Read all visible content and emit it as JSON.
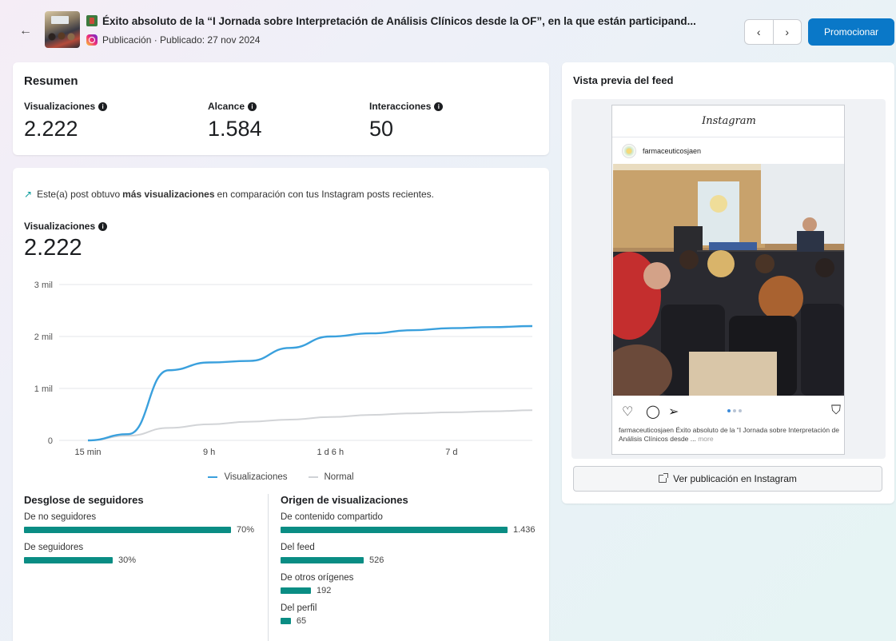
{
  "header": {
    "back_icon": "←",
    "title": "Éxito absoluto de la “I Jornada sobre Interpretación de Análisis Clínicos desde la OF”, en la que están participand...",
    "subtitle": "Publicación · Publicado: 27 nov 2024",
    "prev_icon": "‹",
    "next_icon": "›",
    "promote_label": "Promocionar"
  },
  "summary": {
    "title": "Resumen",
    "metrics": [
      {
        "label": "Visualizaciones",
        "value": "2.222"
      },
      {
        "label": "Alcance",
        "value": "1.584"
      },
      {
        "label": "Interacciones",
        "value": "50"
      }
    ]
  },
  "insight": {
    "prefix": "Este(a) post obtuvo ",
    "bold": "más visualizaciones",
    "suffix": " en comparación con tus Instagram posts recientes."
  },
  "views": {
    "label": "Visualizaciones",
    "value": "2.222"
  },
  "chart_data": {
    "type": "line",
    "x": [
      "15 min",
      "",
      "",
      "9 h",
      "",
      "",
      "1 d 6 h",
      "",
      "",
      "7 d",
      "",
      ""
    ],
    "x_tick_labels": [
      "15 min",
      "9 h",
      "1 d 6 h",
      "7 d"
    ],
    "y_tick_labels": [
      "0",
      "1 mil",
      "2 mil",
      "3 mil"
    ],
    "ylim": [
      0,
      3000
    ],
    "grid": true,
    "legend_position": "bottom",
    "series": [
      {
        "name": "Visualizaciones",
        "color": "#3aa0dd",
        "values": [
          0,
          120,
          1350,
          1500,
          1530,
          1780,
          2000,
          2060,
          2120,
          2160,
          2180,
          2200
        ]
      },
      {
        "name": "Normal",
        "color": "#d2d4d7",
        "values": [
          0,
          90,
          240,
          310,
          360,
          400,
          450,
          490,
          520,
          540,
          560,
          580
        ]
      }
    ]
  },
  "followers": {
    "title": "Desglose de seguidores",
    "items": [
      {
        "label": "De no seguidores",
        "value": "70%",
        "fraction": 0.7
      },
      {
        "label": "De seguidores",
        "value": "30%",
        "fraction": 0.3
      }
    ]
  },
  "origins": {
    "title": "Origen de visualizaciones",
    "items": [
      {
        "label": "De contenido compartido",
        "value": "1.436",
        "amount": 1436
      },
      {
        "label": "Del feed",
        "value": "526",
        "amount": 526
      },
      {
        "label": "De otros orígenes",
        "value": "192",
        "amount": 192
      },
      {
        "label": "Del perfil",
        "value": "65",
        "amount": 65
      }
    ]
  },
  "feed": {
    "title": "Vista previa del feed",
    "logo": "Instagram",
    "username": "farmaceuticosjaen",
    "caption_user": "farmaceuticosjaen",
    "caption_text": " Éxito absoluto de la “I Jornada sobre Interpretación de Análisis Clínicos desde ... ",
    "caption_more": "more",
    "view_button": "Ver publicación en Instagram"
  },
  "colors": {
    "accent": "#0a78c8",
    "bar": "#0a8d84"
  }
}
